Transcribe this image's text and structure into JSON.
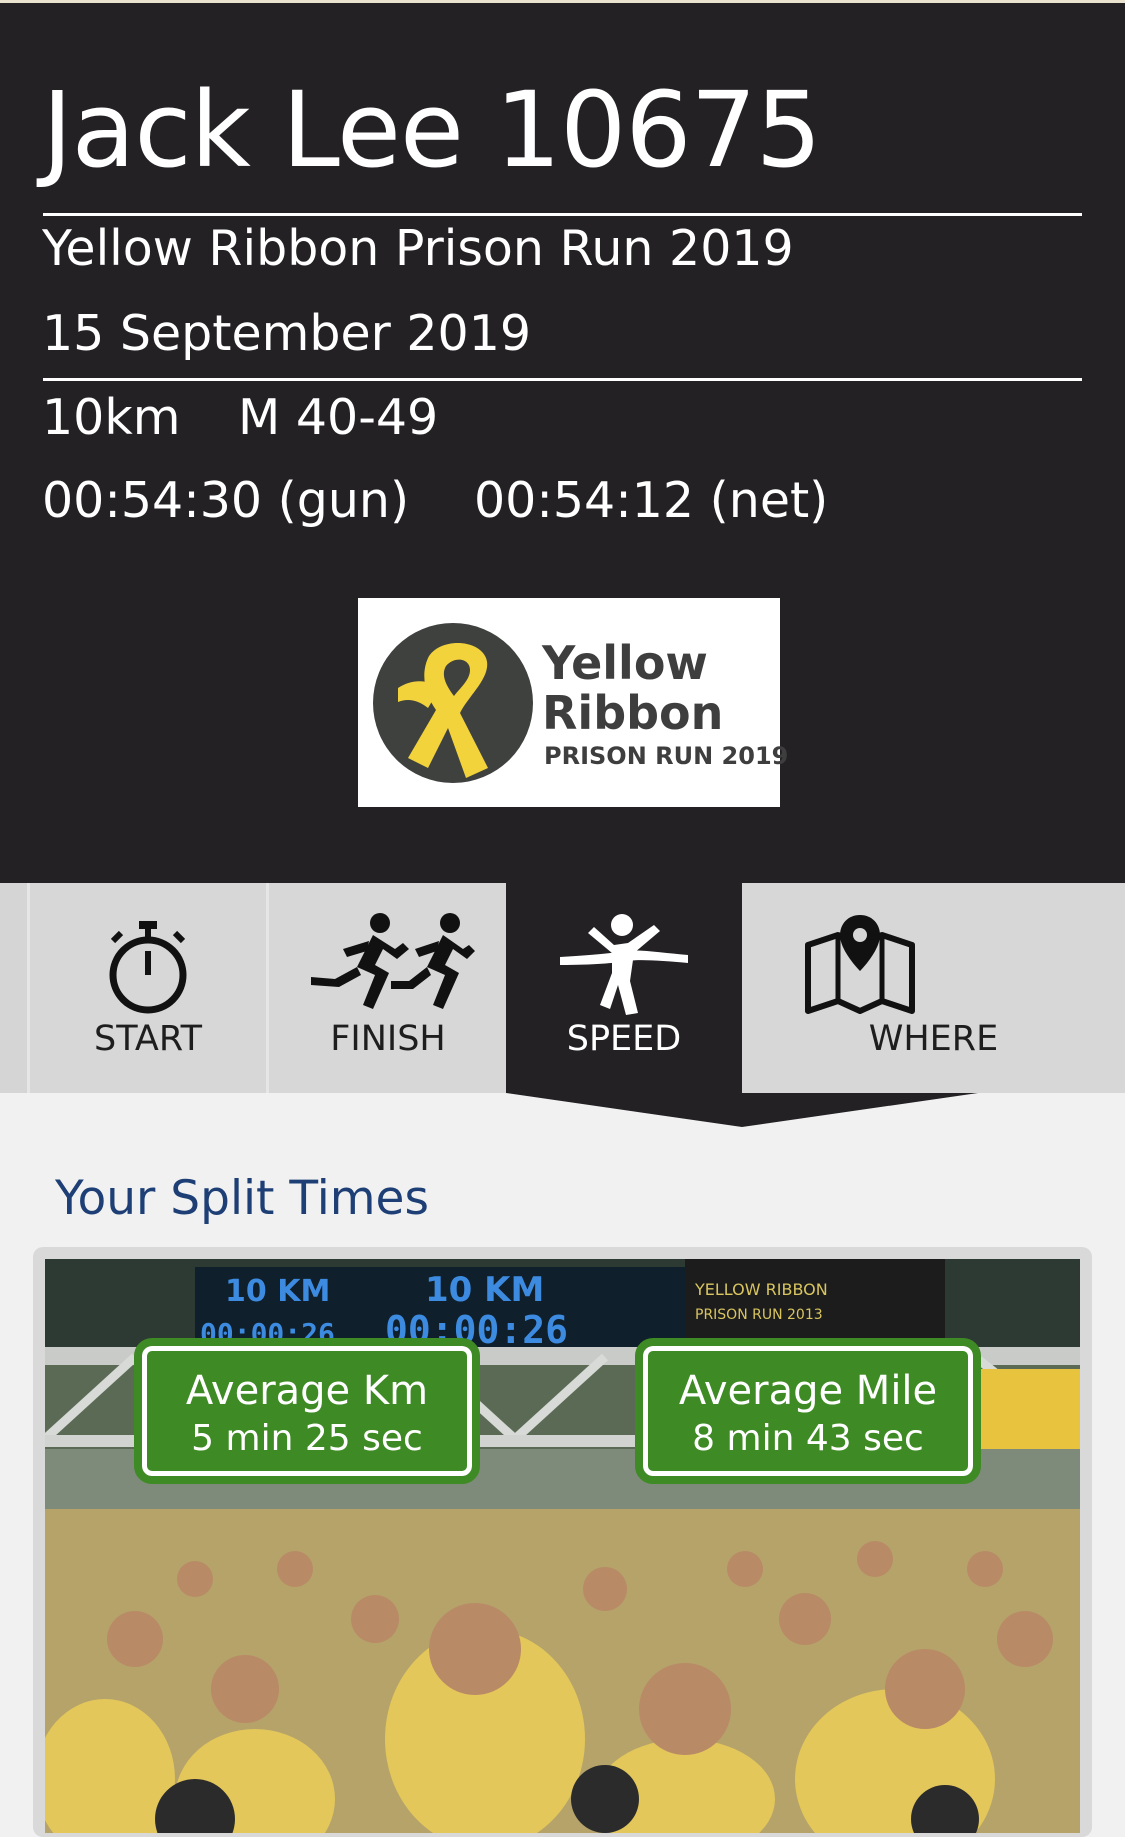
{
  "runner": {
    "name_bib": "Jack Lee 10675",
    "event": "Yellow Ribbon Prison Run 2019",
    "date": "15 September 2019",
    "distance": "10km",
    "category": "M 40-49",
    "gun_time": "00:54:30 (gun)",
    "net_time": "00:54:12 (net)"
  },
  "logo": {
    "line1": "Yellow",
    "line2": "Ribbon",
    "line3": "PRISON RUN 2019"
  },
  "tabs": [
    {
      "label": "START",
      "icon": "stopwatch-icon"
    },
    {
      "label": "FINISH",
      "icon": "runners-icon"
    },
    {
      "label": "SPEED",
      "icon": "finish-line-runner-icon",
      "active": true
    },
    {
      "label": "WHERE",
      "icon": "map-pin-icon"
    }
  ],
  "splits": {
    "title": "Your Split Times",
    "avg_km_label": "Average Km",
    "avg_km_value": "5 min 25 sec",
    "avg_mile_label": "Average Mile",
    "avg_mile_value": "8 min 43 sec"
  },
  "photo_board": {
    "text1": "10 KM",
    "text2": "10 KM",
    "time1": "00:00:26",
    "time2": "00:00:26",
    "sign1": "YELLOW RIBBON",
    "sign2": "PRISON RUN 2013"
  },
  "colors": {
    "header_bg": "#242125",
    "tab_bg": "#d7d7d7",
    "title_blue": "#1d3f75",
    "badge_green": "#3e8a24",
    "ribbon_yellow": "#f3d33b"
  }
}
